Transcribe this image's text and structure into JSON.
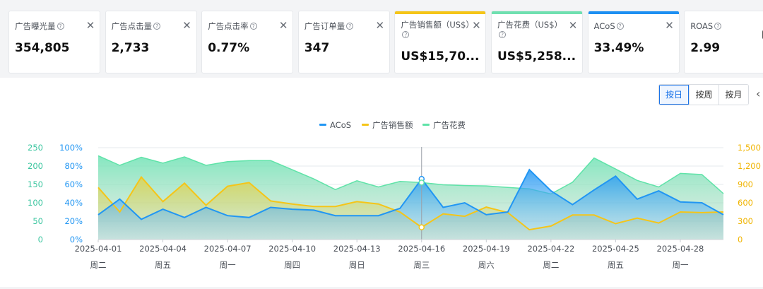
{
  "metrics": [
    {
      "label": "广告曝光量",
      "value": "354,805",
      "accent": ""
    },
    {
      "label": "广告点击量",
      "value": "2,733",
      "accent": ""
    },
    {
      "label": "广告点击率",
      "value": "0.77%",
      "accent": ""
    },
    {
      "label": "广告订单量",
      "value": "347",
      "accent": ""
    },
    {
      "label": "广告销售额（US$）",
      "value": "US$15,70...",
      "accent": "#f5c518"
    },
    {
      "label": "广告花费（US$）",
      "value": "US$5,258...",
      "accent": "#6fe0b0"
    },
    {
      "label": "ACoS",
      "value": "33.49%",
      "accent": "#1d8ff2"
    },
    {
      "label": "ROAS",
      "value": "2.99",
      "accent": ""
    }
  ],
  "granularity": {
    "options": [
      "按日",
      "按周",
      "按月"
    ],
    "selected": "按日"
  },
  "colors": {
    "acos": "#2196f3",
    "sales": "#f5c518",
    "spend": "#5fe3a8",
    "left_outer_axis": "#3cc6a0",
    "left_inner_axis": "#2196f3",
    "right_axis": "#f0b400"
  },
  "chart_data": {
    "type": "area",
    "x": [
      "2025-04-01",
      "2025-04-02",
      "2025-04-03",
      "2025-04-04",
      "2025-04-05",
      "2025-04-06",
      "2025-04-07",
      "2025-04-08",
      "2025-04-09",
      "2025-04-10",
      "2025-04-11",
      "2025-04-12",
      "2025-04-13",
      "2025-04-14",
      "2025-04-15",
      "2025-04-16",
      "2025-04-17",
      "2025-04-18",
      "2025-04-19",
      "2025-04-20",
      "2025-04-21",
      "2025-04-22",
      "2025-04-23",
      "2025-04-24",
      "2025-04-25",
      "2025-04-26",
      "2025-04-27",
      "2025-04-28",
      "2025-04-29",
      "2025-04-30"
    ],
    "x_tick_labels": [
      "2025-04-01",
      "2025-04-04",
      "2025-04-07",
      "2025-04-10",
      "2025-04-13",
      "2025-04-16",
      "2025-04-19",
      "2025-04-22",
      "2025-04-25",
      "2025-04-28"
    ],
    "weekday_labels": [
      "周二",
      "周五",
      "周一",
      "周四",
      "周日",
      "周三",
      "周六",
      "周二",
      "周五",
      "周一"
    ],
    "legend": [
      "ACoS",
      "广告销售额",
      "广告花费"
    ],
    "legend_position": "top-center",
    "series": [
      {
        "name": "ACoS",
        "axis": "left-inner",
        "unit": "%",
        "values": [
          27,
          44,
          22,
          33,
          24,
          35,
          26,
          24,
          35,
          33,
          32,
          26,
          26,
          26,
          34,
          66,
          35,
          40,
          27,
          30,
          76,
          53,
          38,
          54,
          69,
          44,
          53,
          41,
          40,
          27
        ]
      },
      {
        "name": "广告销售额",
        "axis": "right",
        "values": [
          850,
          450,
          1020,
          620,
          920,
          560,
          870,
          930,
          630,
          580,
          540,
          540,
          620,
          580,
          450,
          200,
          420,
          380,
          530,
          440,
          160,
          220,
          400,
          400,
          260,
          350,
          270,
          450,
          440,
          450
        ]
      },
      {
        "name": "广告花费",
        "axis": "left-outer",
        "values": [
          228,
          202,
          224,
          208,
          225,
          202,
          212,
          215,
          215,
          190,
          165,
          136,
          160,
          143,
          158,
          155,
          149,
          147,
          146,
          142,
          138,
          124,
          156,
          222,
          192,
          161,
          143,
          180,
          177,
          125
        ]
      }
    ],
    "axes": {
      "left_outer": {
        "ticks": [
          "250",
          "200",
          "150",
          "100",
          "50",
          "0"
        ],
        "range": [
          0,
          250
        ]
      },
      "left_inner": {
        "ticks": [
          "100%",
          "80%",
          "60%",
          "40%",
          "20%",
          "0%"
        ],
        "range": [
          0,
          100
        ]
      },
      "right": {
        "ticks": [
          "1,500",
          "1,200",
          "900",
          "600",
          "300",
          "0"
        ],
        "range": [
          0,
          1500
        ]
      }
    },
    "hover_index": 15,
    "grid": true
  }
}
